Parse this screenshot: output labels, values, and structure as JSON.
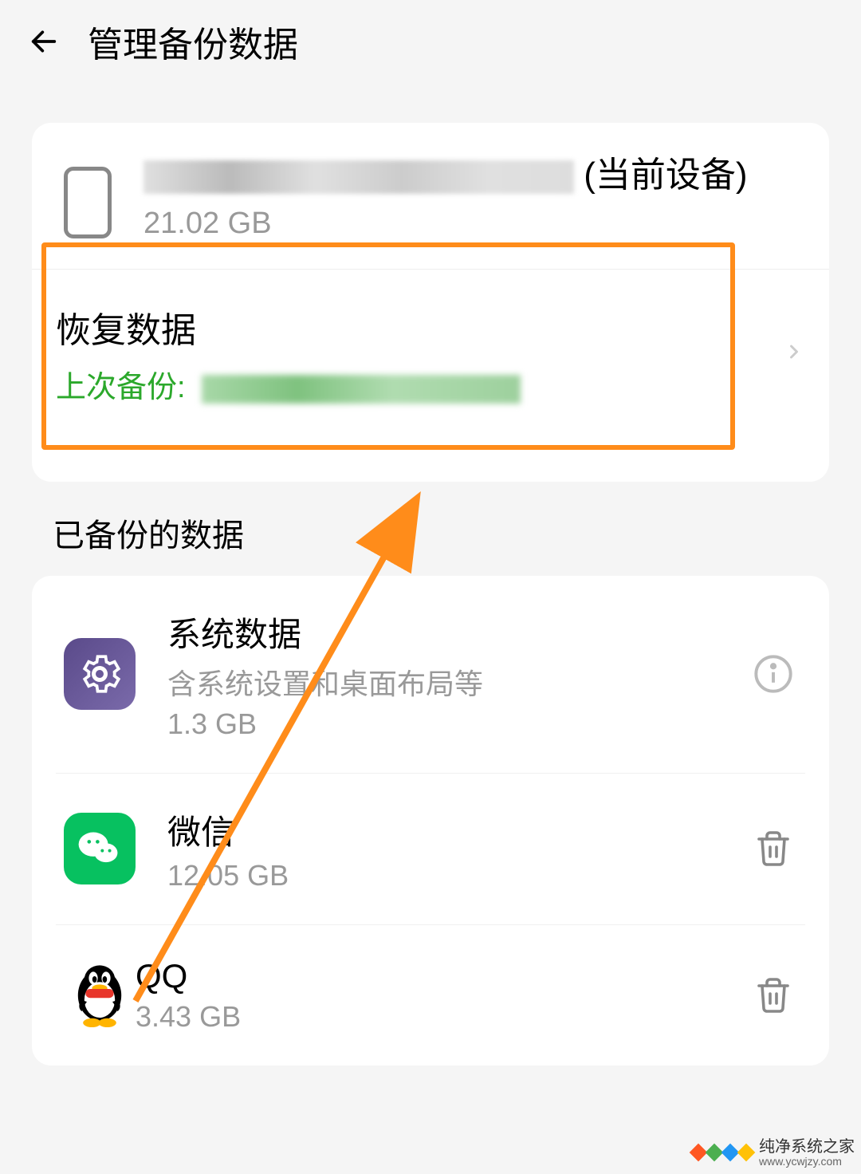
{
  "header": {
    "title": "管理备份数据"
  },
  "device": {
    "label_suffix": "(当前设备)",
    "size": "21.02 GB"
  },
  "restore": {
    "title": "恢复数据",
    "last_backup_label": "上次备份: "
  },
  "section": {
    "title": "已备份的数据"
  },
  "items": [
    {
      "name": "系统数据",
      "desc": "含系统设置和桌面布局等",
      "size": "1.3 GB",
      "action": "info"
    },
    {
      "name": "微信",
      "desc": "",
      "size": "12.05 GB",
      "action": "delete"
    },
    {
      "name": "QQ",
      "desc": "",
      "size": "3.43 GB",
      "action": "delete"
    }
  ],
  "watermark": {
    "name": "纯净系统之家",
    "url": "www.ycwjzy.com"
  }
}
